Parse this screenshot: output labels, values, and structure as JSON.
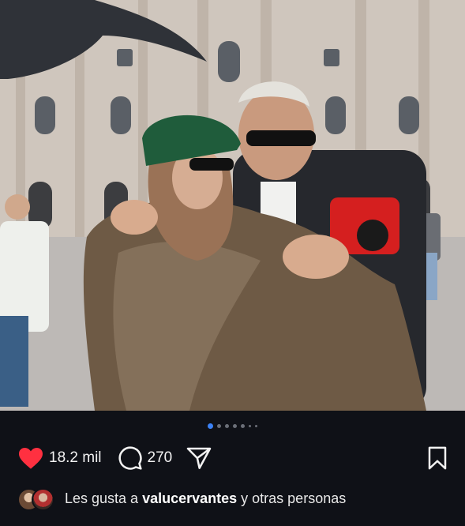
{
  "post": {
    "photo": {
      "description_icon": "photo-image"
    },
    "carousel": {
      "total_dots": 7,
      "active_index": 0
    },
    "actions": {
      "like_icon": "heart-filled-icon",
      "like_count": "18.2 mil",
      "comment_icon": "comment-bubble-icon",
      "comment_count": "270",
      "share_icon": "paper-plane-icon",
      "save_icon": "bookmark-icon",
      "like_color": "#ff3040"
    },
    "likes_line": {
      "prefix": "Les gusta a",
      "user": "valucervantes",
      "suffix": "y otras personas"
    }
  }
}
